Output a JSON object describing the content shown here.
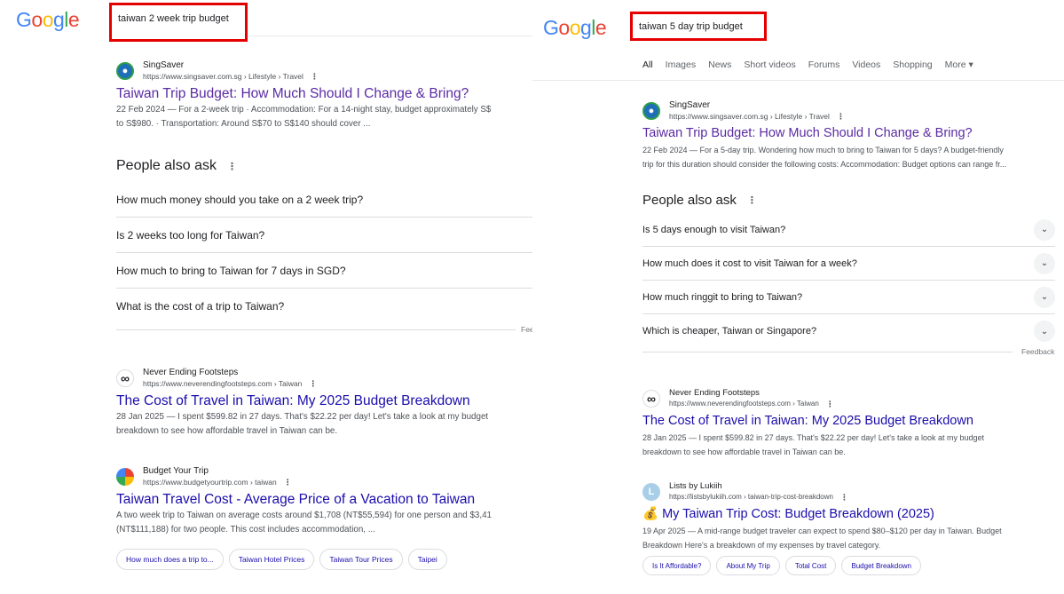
{
  "left": {
    "logo": "Google",
    "query": "taiwan 2 week trip budget",
    "results": [
      {
        "site": "SingSaver",
        "url": "https://www.singsaver.com.sg › Lifestyle › Travel",
        "title": "Taiwan Trip Budget: How Much Should I Change & Bring?",
        "snippet1": "22 Feb 2024 — For a 2-week trip · Accommodation: For a 14-night stay, budget approximately S$",
        "snippet2": "to S$980. · Transportation: Around S$70 to S$140 should cover ..."
      },
      {
        "site": "Never Ending Footsteps",
        "url": "https://www.neverendingfootsteps.com › Taiwan",
        "title": "The Cost of Travel in Taiwan: My 2025 Budget Breakdown",
        "snippet1": "28 Jan 2025 — I spent $599.82 in 27 days. That's $22.22 per day! Let's take a look at my budget",
        "snippet2": "breakdown to see how affordable travel in Taiwan can be."
      },
      {
        "site": "Budget Your Trip",
        "url": "https://www.budgetyourtrip.com › taiwan",
        "title": "Taiwan Travel Cost - Average Price of a Vacation to Taiwan",
        "snippet1": "A two week trip to Taiwan on average costs around $1,708 (NT$55,594) for one person and $3,41",
        "snippet2": "(NT$111,188) for two people. This cost includes accommodation, ..."
      }
    ],
    "paa_title": "People also ask",
    "paa": [
      "How much money should you take on a 2 week trip?",
      "Is 2 weeks too long for Taiwan?",
      "How much to bring to Taiwan for 7 days in SGD?",
      "What is the cost of a trip to Taiwan?"
    ],
    "feedback": "Fee",
    "chips": [
      "How much does a trip to...",
      "Taiwan Hotel Prices",
      "Taiwan Tour Prices",
      "Taipei"
    ]
  },
  "right": {
    "logo": "Google",
    "query": "taiwan 5 day trip budget",
    "tabs": [
      "All",
      "Images",
      "News",
      "Short videos",
      "Forums",
      "Videos",
      "Shopping",
      "More ▾"
    ],
    "results": [
      {
        "site": "SingSaver",
        "url": "https://www.singsaver.com.sg › Lifestyle › Travel",
        "title": "Taiwan Trip Budget: How Much Should I Change & Bring?",
        "snippet1": "22 Feb 2024 — For a 5-day trip. Wondering how much to bring to Taiwan for 5 days? A budget-friendly",
        "snippet2": "trip for this duration should consider the following costs: Accommodation: Budget options can range fr..."
      },
      {
        "site": "Never Ending Footsteps",
        "url": "https://www.neverendingfootsteps.com › Taiwan",
        "title": "The Cost of Travel in Taiwan: My 2025 Budget Breakdown",
        "snippet1": "28 Jan 2025 — I spent $599.82 in 27 days. That's $22.22 per day! Let's take a look at my budget",
        "snippet2": "breakdown to see how affordable travel in Taiwan can be."
      },
      {
        "site": "Lists by Lukiih",
        "url": "https://listsbylukiih.com › taiwan-trip-cost-breakdown",
        "title": "💰 My Taiwan Trip Cost: Budget Breakdown (2025)",
        "snippet1": "19 Apr 2025 — A mid-range budget traveler can expect to spend $80–$120 per day in Taiwan. Budget",
        "snippet2": "Breakdown Here's a breakdown of my expenses by travel category."
      }
    ],
    "paa_title": "People also ask",
    "paa": [
      "Is 5 days enough to visit Taiwan?",
      "How much does it cost to visit Taiwan for a week?",
      "How much ringgit to bring to Taiwan?",
      "Which is cheaper, Taiwan or Singapore?"
    ],
    "feedback": "Feedback",
    "chips": [
      "Is It Affordable?",
      "About My Trip",
      "Total Cost",
      "Budget Breakdown"
    ]
  },
  "colors": {
    "highlight_box": "#e50000",
    "link_visited": "#5b2ba4",
    "link": "#1a0dab"
  }
}
